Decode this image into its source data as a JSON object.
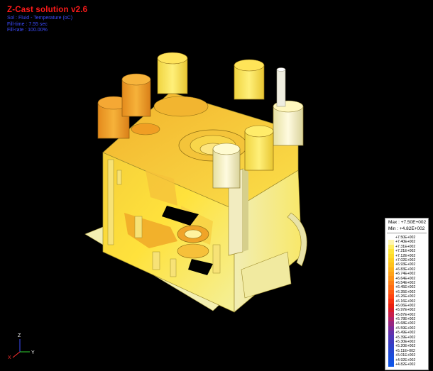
{
  "header": {
    "title": "Z-Cast solution v2.6",
    "line1": "Sol : Fluid - Temperature (oC)",
    "line2": "Fill-time : 7.55 sec",
    "line3": "Fill-rate : 100.00%"
  },
  "legend": {
    "max_label": "Max : +7.50E+002",
    "min_label": "Min : +4.82E+002",
    "ticks": [
      "+7.50E+002",
      "+7.40E+002",
      "+7.31E+002",
      "+7.21E+002",
      "+7.12E+002",
      "+7.02E+002",
      "+6.93E+002",
      "+6.83E+002",
      "+6.74E+002",
      "+6.64E+002",
      "+6.54E+002",
      "+6.45E+002",
      "+6.35E+002",
      "+6.26E+002",
      "+6.16E+002",
      "+6.06E+002",
      "+5.97E+002",
      "+5.87E+002",
      "+5.78E+002",
      "+5.68E+002",
      "+5.59E+002",
      "+5.49E+002",
      "+5.39E+002",
      "+5.30E+002",
      "+5.20E+002",
      "+5.11E+002",
      "+5.01E+002",
      "+4.92E+002",
      "+4.82E+002"
    ],
    "colors": [
      "#ffffff",
      "#fff6b0",
      "#ffee66",
      "#ffe53a",
      "#ffdb2a",
      "#ffcf22",
      "#ffc21f",
      "#ffb31c",
      "#ffa31a",
      "#ff9318",
      "#ff8016",
      "#ff6e14",
      "#ff5a12",
      "#ff4410",
      "#f6300f",
      "#e8200f",
      "#d81b2a",
      "#c81e4a",
      "#b02268",
      "#962680",
      "#7c2a98",
      "#6430aa",
      "#5036b6",
      "#3e3ac0",
      "#3040c8",
      "#2646d0",
      "#1c4cd8",
      "#1550e0",
      "#0f55e8"
    ]
  },
  "axes": {
    "z": "Z",
    "x": "X",
    "y": "Y"
  }
}
